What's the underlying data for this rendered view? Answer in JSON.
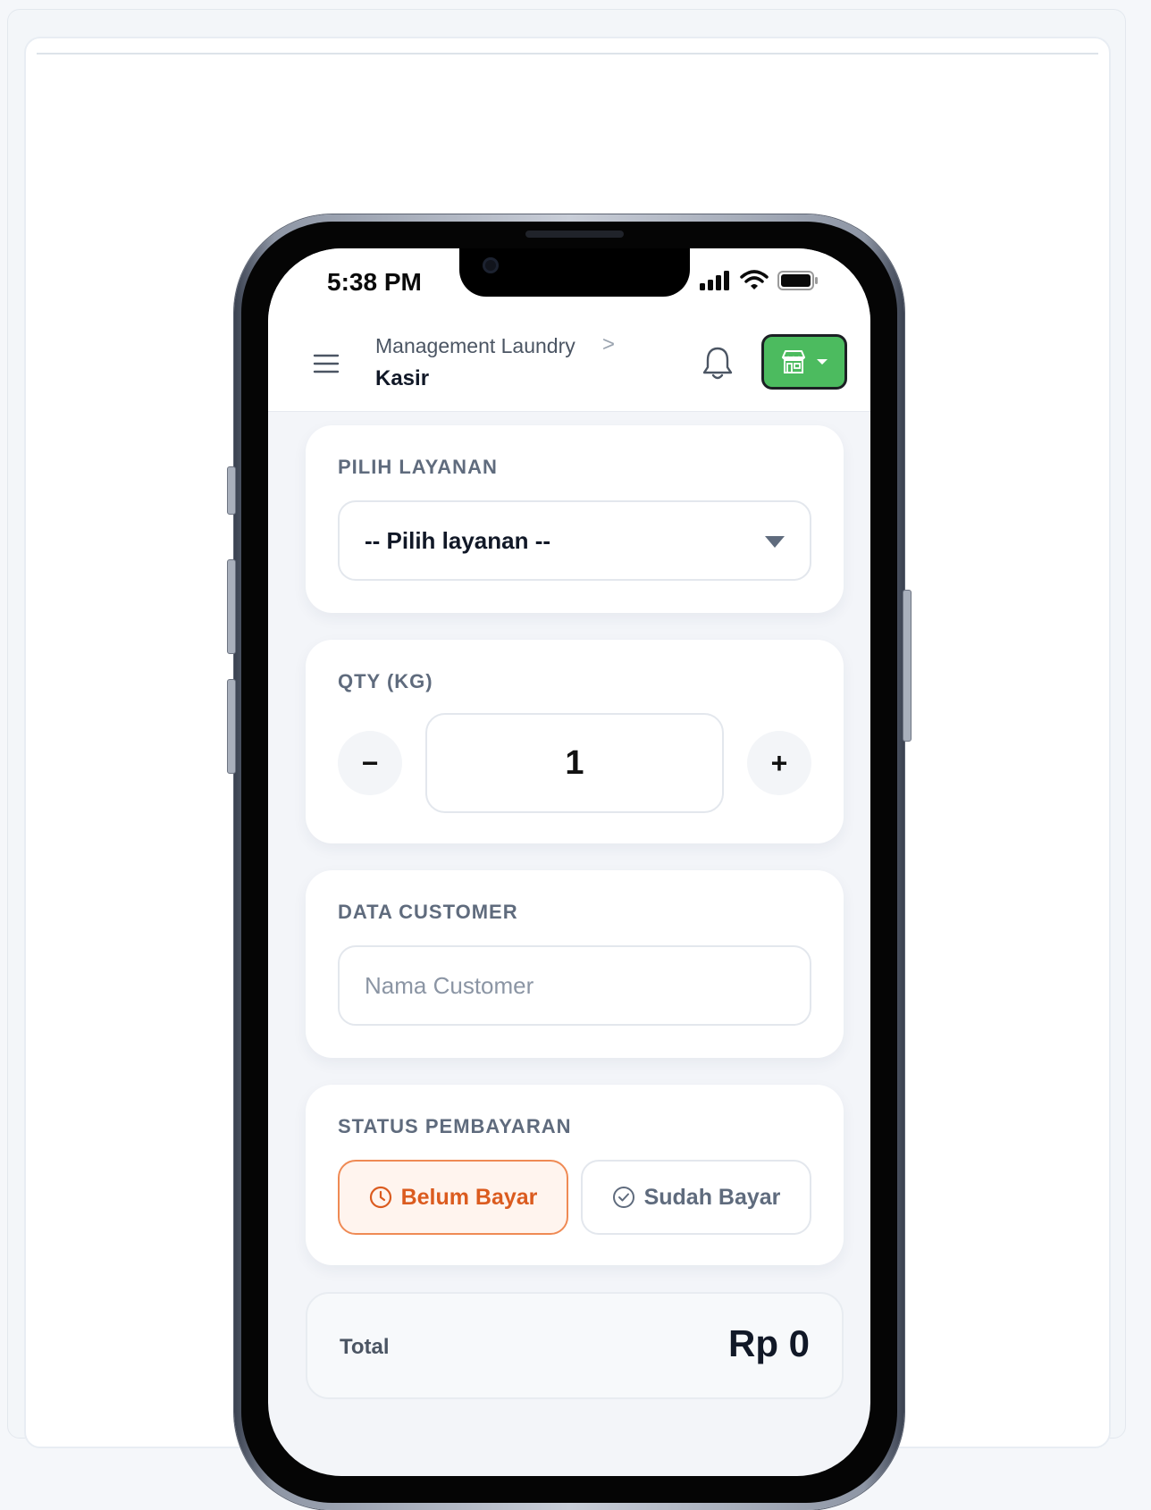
{
  "status_bar": {
    "time": "5:38 PM"
  },
  "header": {
    "breadcrumb_parent": "Management Laundry",
    "breadcrumb_separator": ">",
    "breadcrumb_current": "Kasir",
    "menu_icon": "hamburger-icon",
    "notification_icon": "bell-icon",
    "store_icon": "store-icon",
    "store_button_color": "#4cbb5f"
  },
  "service": {
    "label": "PILIH LAYANAN",
    "selected": "-- Pilih layanan --"
  },
  "quantity": {
    "label": "QTY (KG)",
    "decrement": "−",
    "value": "1",
    "increment": "+"
  },
  "customer": {
    "label": "DATA CUSTOMER",
    "name_value": "",
    "name_placeholder": "Nama Customer"
  },
  "payment": {
    "label": "STATUS PEMBAYARAN",
    "unpaid_label": "Belum Bayar",
    "paid_label": "Sudah Bayar",
    "selected": "Belum Bayar",
    "unpaid_color": "#db5b1f"
  },
  "total": {
    "label": "Total",
    "value": "Rp 0"
  }
}
